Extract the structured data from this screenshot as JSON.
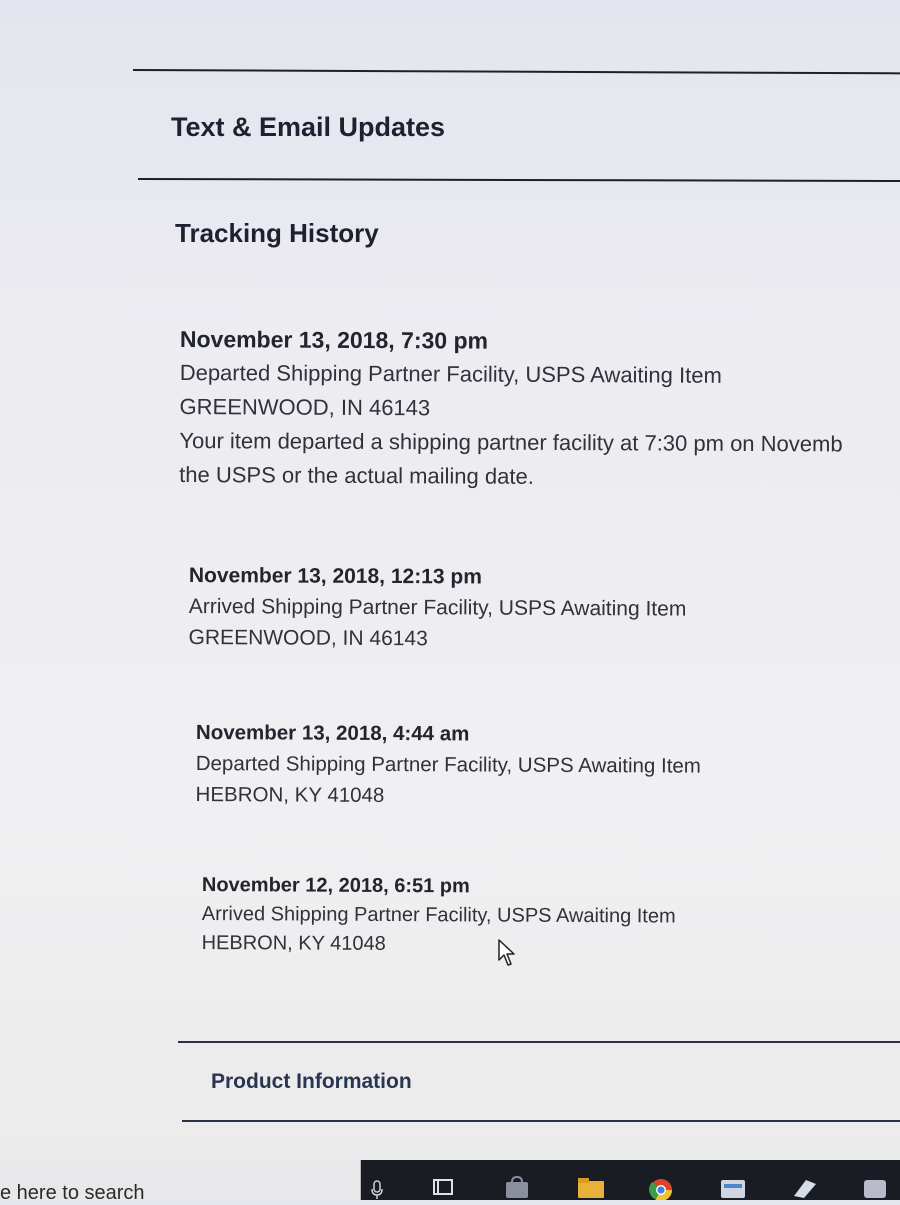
{
  "sections": {
    "text_email_updates": "Text & Email Updates",
    "tracking_history": "Tracking History",
    "product_information": "Product Information"
  },
  "tracking_events": [
    {
      "date": "November 13, 2018, 7:30 pm",
      "status": "Departed Shipping Partner Facility, USPS Awaiting Item",
      "location": "GREENWOOD, IN 46143",
      "description_line1": "Your item departed a shipping partner facility at 7:30 pm on Novemb",
      "description_line2": "the USPS or the actual mailing date."
    },
    {
      "date": "November 13, 2018, 12:13 pm",
      "status": "Arrived Shipping Partner Facility, USPS Awaiting Item",
      "location": "GREENWOOD, IN 46143"
    },
    {
      "date": "November 13, 2018, 4:44 am",
      "status": "Departed Shipping Partner Facility, USPS Awaiting Item",
      "location": "HEBRON, KY 41048"
    },
    {
      "date": "November 12, 2018, 6:51 pm",
      "status": "Arrived Shipping Partner Facility, USPS Awaiting Item",
      "location": "HEBRON, KY 41048"
    }
  ],
  "taskbar": {
    "search_text": "e here to search",
    "icons": [
      "mic-icon",
      "task-view-icon",
      "store-icon",
      "file-explorer-icon",
      "chrome-icon",
      "app-icon",
      "app-icon",
      "app-icon"
    ],
    "colors": {
      "chrome": "#d9452f",
      "explorer": "#e8b23a",
      "store": "#8a8fa0"
    }
  },
  "colors": {
    "rule": "#1d1f2a",
    "heading": "#1e2130",
    "product_heading": "#2a3552"
  }
}
